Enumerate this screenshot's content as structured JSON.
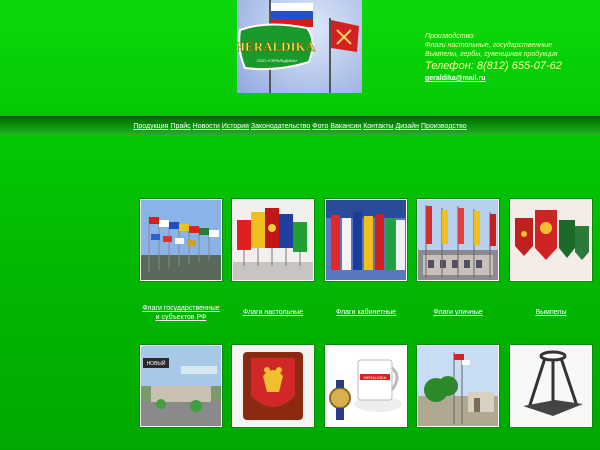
{
  "logo": {
    "text": "HERALDIKA",
    "subtext": "ООО «ГЕРАЛЬДИКА»"
  },
  "contact": {
    "line1": "Производство:",
    "line2": "Флаги настольные, государственные",
    "line3": "Вымпелы, гербы, сувенирная продукция",
    "phone": "Телефон: 8(812) 655-07-62",
    "email": "geraldika@mail.ru"
  },
  "nav": [
    "Продукция",
    "Прайс",
    "Новости",
    "История",
    "Законодательство",
    "Фото",
    "Вакансии",
    "Контакты",
    "Дизайн",
    "Производство"
  ],
  "products_row1": [
    {
      "line1": "Флаги государственные",
      "line2": "и субъектов РФ"
    },
    {
      "line1": "Флаги настольные",
      "line2": ""
    },
    {
      "line1": "Флаги кабинетные",
      "line2": ""
    },
    {
      "line1": "Флаги уличные",
      "line2": ""
    },
    {
      "line1": "Вымпелы",
      "line2": ""
    }
  ],
  "row2_partial": {
    "badge_text": "НОВЫЙ",
    "mug_text": "HERALDIKA"
  }
}
